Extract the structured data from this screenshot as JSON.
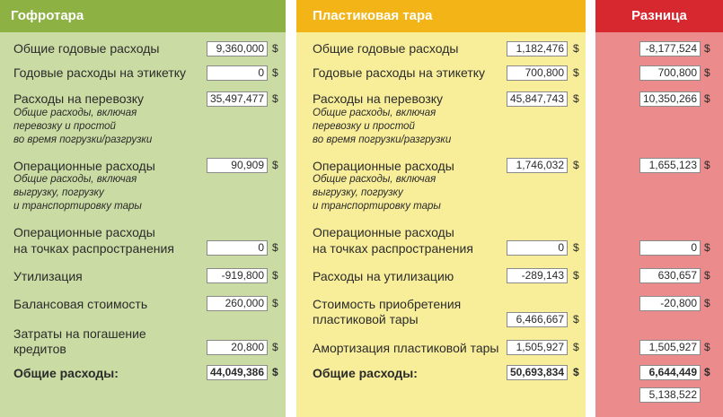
{
  "colors": {
    "corrugated_header": "#8db142",
    "corrugated_bg": "#cadba3",
    "plastic_header": "#f2b417",
    "plastic_bg": "#f8ee9a",
    "diff_header": "#d7282f",
    "diff_bg": "#ec8b8b"
  },
  "currency": "$",
  "corrugated": {
    "title": "Гофротара",
    "annual_total_label": "Общие годовые расходы",
    "annual_total_value": "9,360,000",
    "label_cost_label": "Годовые расходы на этикетку",
    "label_cost_value": "0",
    "transport_label": "Расходы на перевозку",
    "transport_value": "35,497,477",
    "transport_note_1": "Общие расходы, включая",
    "transport_note_2": "перевозку и простой",
    "transport_note_3": "во время погрузки/разгрузки",
    "operational_label": "Операционные расходы",
    "operational_value": "90,909",
    "operational_note_1": "Общие расходы, включая",
    "operational_note_2": "выгрузку, погрузку",
    "operational_note_3": "и транспортировку тары",
    "distribution_label_1": "Операционные расходы",
    "distribution_label_2": "на точках распространения",
    "distribution_value": "0",
    "disposal_label": "Утилизация",
    "disposal_value": "-919,800",
    "book_value_label": "Балансовая стоимость",
    "book_value_value": "260,000",
    "loan_label_1": "Затраты на погашение",
    "loan_label_2": "кредитов",
    "loan_value": "20,800",
    "total_label": "Общие расходы:",
    "total_value": "44,049,386"
  },
  "plastic": {
    "title": "Пластиковая тара",
    "annual_total_label": "Общие годовые расходы",
    "annual_total_value": "1,182,476",
    "label_cost_label": "Годовые расходы на этикетку",
    "label_cost_value": "700,800",
    "transport_label": "Расходы на перевозку",
    "transport_value": "45,847,743",
    "transport_note_1": "Общие расходы, включая",
    "transport_note_2": "перевозку и простой",
    "transport_note_3": "во время погрузки/разгрузки",
    "operational_label": "Операционные расходы",
    "operational_value": "1,746,032",
    "operational_note_1": "Общие расходы, включая",
    "operational_note_2": "выгрузку, погрузку",
    "operational_note_3": "и транспортировку тары",
    "distribution_label_1": "Операционные расходы",
    "distribution_label_2": "на точках распространения",
    "distribution_value": "0",
    "disposal_label": "Расходы на утилизацию",
    "disposal_value": "-289,143",
    "acquisition_label_1": "Стоимость приобретения",
    "acquisition_label_2": "пластиковой тары",
    "acquisition_value": "6,466,667",
    "amortization_label": "Амортизация пластиковой тары",
    "amortization_value": "1,505,927",
    "total_label": "Общие расходы:",
    "total_value": "50,693,834"
  },
  "difference": {
    "title": "Разница",
    "annual_total_value": "-8,177,524",
    "label_cost_value": "700,800",
    "transport_value": "10,350,266",
    "operational_value": "1,655,123",
    "distribution_value": "0",
    "disposal_value": "630,657",
    "acquisition_value": "-20,800",
    "amortization_value": "1,505,927",
    "total_value": "6,644,449",
    "extra_value": "5,138,522"
  }
}
